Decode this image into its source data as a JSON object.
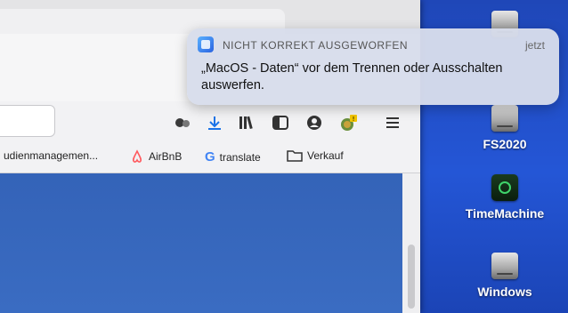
{
  "notification": {
    "title": "NICHT KORREKT AUSGEWORFEN",
    "time": "jetzt",
    "body": "„MacOS - Daten“ vor dem Trennen oder Ausschalten auswerfen."
  },
  "bookmarks": [
    {
      "label": "udienmanagemen...",
      "icon": "folder-icon"
    },
    {
      "label": "AirBnB",
      "icon": "airbnb-icon"
    },
    {
      "label": "translate",
      "icon": "google-icon"
    },
    {
      "label": "Verkauf",
      "icon": "folder-icon"
    }
  ],
  "desktop": {
    "items": [
      {
        "label": "FS2020",
        "icon": "hard-disk-icon"
      },
      {
        "label": "TimeMachine",
        "icon": "time-machine-disk-icon"
      },
      {
        "label": "Windows",
        "icon": "hard-disk-icon"
      }
    ]
  },
  "toolbar_icons": [
    "extensions-icon",
    "download-icon",
    "library-icon",
    "sidebar-icon",
    "account-icon",
    "extension-alert-icon",
    "menu-icon"
  ],
  "colors": {
    "desktop_blue": "#2456d6",
    "download_blue": "#1a73e8",
    "notif_bg": "#d7ddeb"
  }
}
